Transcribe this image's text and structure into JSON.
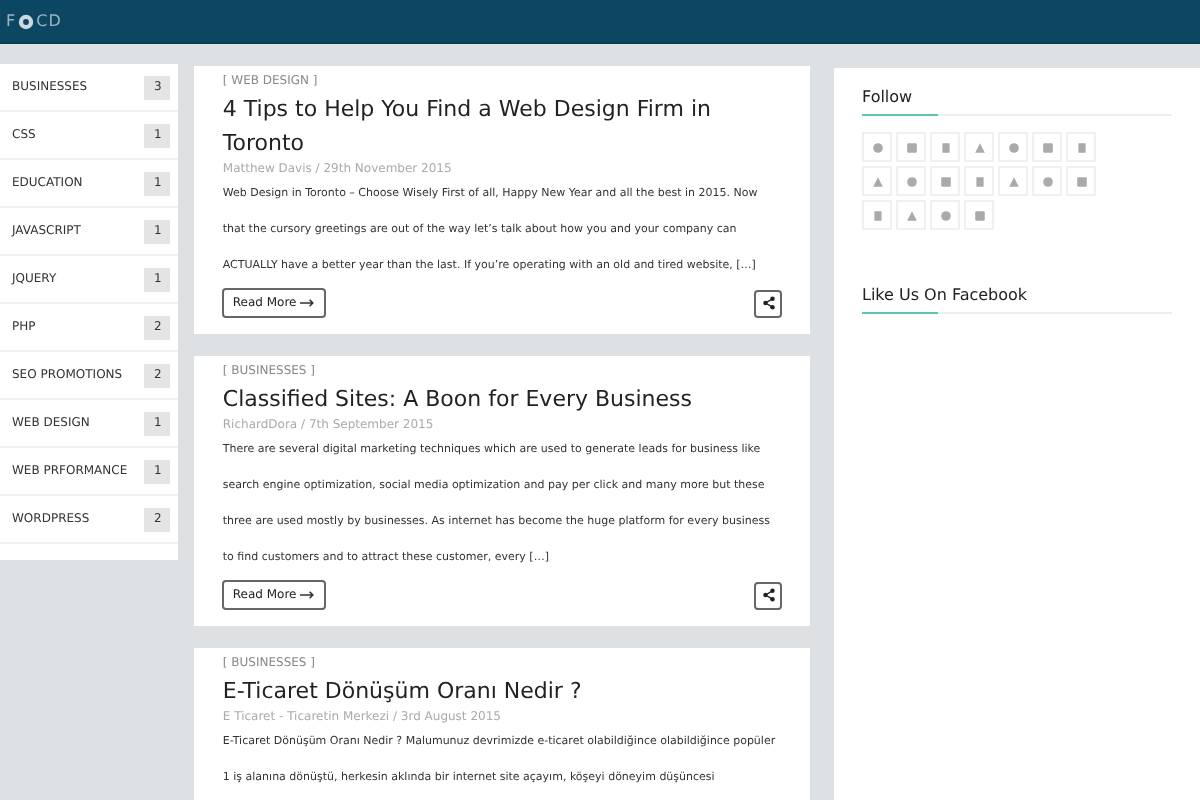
{
  "header": {
    "logo_before": "F",
    "logo_after": "CD"
  },
  "categories": [
    {
      "label": "BUSINESSES",
      "count": "3"
    },
    {
      "label": "CSS",
      "count": "1"
    },
    {
      "label": "EDUCATION",
      "count": "1"
    },
    {
      "label": "JAVASCRIPT",
      "count": "1"
    },
    {
      "label": "JQUERY",
      "count": "1"
    },
    {
      "label": "PHP",
      "count": "2"
    },
    {
      "label": "SEO PROMOTIONS",
      "count": "2"
    },
    {
      "label": "WEB DESIGN",
      "count": "1"
    },
    {
      "label": "WEB PRFORMANCE",
      "count": "1"
    },
    {
      "label": "WORDPRESS",
      "count": "2"
    }
  ],
  "posts": [
    {
      "category": "[ WEB DESIGN ]",
      "title": "4 Tips to Help You Find a Web Design Firm in Toronto",
      "meta": "Matthew Davis / 29th November 2015",
      "excerpt": "Web Design in Toronto – Choose Wisely First of all, Happy New Year and all the best in 2015. Now that the cursory greetings are out of the way let’s talk about how you and your company can ACTUALLY have a better year than the last. If you’re operating with an old and tired website, […]",
      "read_more": "Read More"
    },
    {
      "category": "[ BUSINESSES ]",
      "title": "Classified Sites: A Boon for Every Business",
      "meta": "RichardDora / 7th September 2015",
      "excerpt": "There are several digital marketing techniques which are used to generate leads for business like search engine optimization, social media optimization and pay per click and many more but these three are used mostly by businesses. As internet has become the huge platform for every business to find customers and to attract these customer, every […]",
      "read_more": "Read More"
    },
    {
      "category": "[ BUSINESSES ]",
      "title": "E-Ticaret Dönüşüm Oranı Nedir ?",
      "meta": "E Ticaret - Ticaretin Merkezi / 3rd August 2015",
      "excerpt": "E-Ticaret Dönüşüm Oranı Nedir ?   Malumunuz devrimizde e-ticaret olabildiğince olabildiğince popüler 1 iş alanına dönüştü, herkesin aklında bir internet site açayım, köşeyi döneyim düşüncesi"
    }
  ],
  "widgets": [
    {
      "kind": "follow",
      "title": "Follow"
    },
    {
      "kind": "facebook",
      "title": "Like Us On Facebook"
    }
  ]
}
